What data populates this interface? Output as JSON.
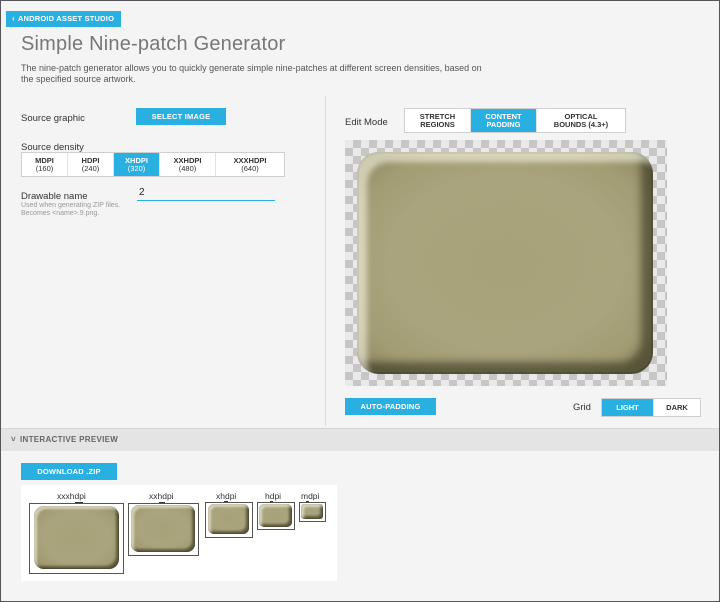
{
  "header": {
    "back_label": "ANDROID ASSET STUDIO",
    "title": "Simple Nine-patch Generator",
    "description": "The nine-patch generator allows you to quickly generate simple nine-patches at different screen densities, based on the specified source artwork."
  },
  "source_graphic": {
    "label": "Source graphic",
    "button": "SELECT IMAGE"
  },
  "source_density": {
    "label": "Source density",
    "options": [
      {
        "name": "MDPI",
        "value": "(160)"
      },
      {
        "name": "HDPI",
        "value": "(240)"
      },
      {
        "name": "XHDPI",
        "value": "(320)"
      },
      {
        "name": "XXHDPI",
        "value": "(480)"
      },
      {
        "name": "XXXHDPI",
        "value": "(640)"
      }
    ],
    "selected": "XHDPI"
  },
  "drawable_name": {
    "label": "Drawable name",
    "value": "2",
    "hint": "Used when generating ZIP files. Becomes <name>.9.png."
  },
  "edit_mode": {
    "label": "Edit Mode",
    "options": [
      {
        "line1": "STRETCH",
        "line2": "REGIONS"
      },
      {
        "line1": "CONTENT",
        "line2": "PADDING"
      },
      {
        "line1": "OPTICAL",
        "line2": "BOUNDS (4.3+)"
      }
    ],
    "selected": "CONTENT"
  },
  "auto_padding_button": "AUTO-PADDING",
  "grid": {
    "label": "Grid",
    "options": [
      "LIGHT",
      "DARK"
    ],
    "selected": "LIGHT"
  },
  "preview_section": {
    "label": "INTERACTIVE PREVIEW"
  },
  "download_button": "DOWNLOAD .ZIP",
  "preview": {
    "densities": [
      "xxxhdpi",
      "xxhdpi",
      "xhdpi",
      "hdpi",
      "mdpi"
    ]
  },
  "colors": {
    "accent": "#29b0e0",
    "patch": "#a8a27a",
    "background": "#f4f4f4"
  }
}
